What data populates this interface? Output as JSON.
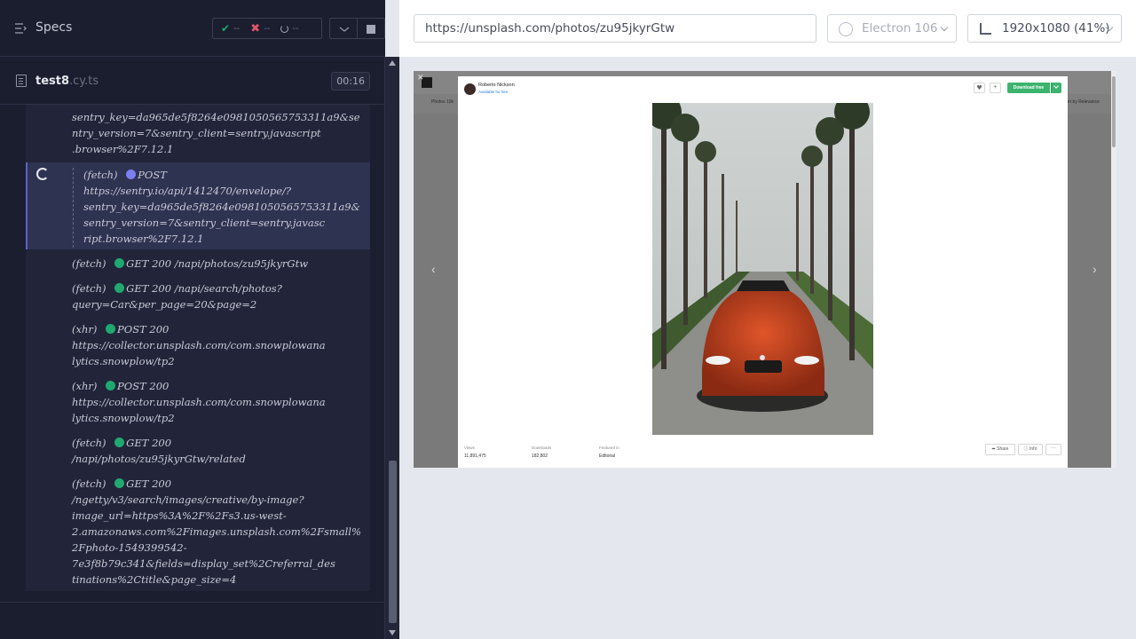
{
  "sidebar": {
    "specs_label": "Specs",
    "stats": {
      "passed": "--",
      "failed": "--",
      "pending": "--"
    },
    "file": {
      "name": "test8",
      "ext": ".cy.ts",
      "timer": "00:16"
    }
  },
  "command_log": [
    {
      "lines": [
        "sentry_key=da965de5f8264e0981050565753311a9&se",
        "ntry_version=7&sentry_client=sentry.javascript",
        ".browser%2F7.12.1"
      ]
    },
    {
      "type": "(fetch)",
      "method": "POST",
      "status": "",
      "dot": "blue",
      "active": true,
      "lines": [
        "https://sentry.io/api/1412470/envelope/?",
        "sentry_key=da965de5f8264e0981050565753311a9&",
        "sentry_version=7&sentry_client=sentry.javasc",
        "ript.browser%2F7.12.1"
      ]
    },
    {
      "type": "(fetch)",
      "method": "GET",
      "status": "200",
      "dot": "green",
      "inline": "/napi/photos/zu95jkyrGtw"
    },
    {
      "type": "(fetch)",
      "method": "GET",
      "status": "200",
      "dot": "green",
      "inline": "/napi/search/photos?",
      "lines": [
        "query=Car&per_page=20&page=2"
      ]
    },
    {
      "type": "(xhr)",
      "method": "POST",
      "status": "200",
      "dot": "green",
      "lines": [
        "https://collector.unsplash.com/com.snowplowana",
        "lytics.snowplow/tp2"
      ]
    },
    {
      "type": "(xhr)",
      "method": "POST",
      "status": "200",
      "dot": "green",
      "lines": [
        "https://collector.unsplash.com/com.snowplowana",
        "lytics.snowplow/tp2"
      ]
    },
    {
      "type": "(fetch)",
      "method": "GET",
      "status": "200",
      "dot": "green",
      "lines": [
        "/napi/photos/zu95jkyrGtw/related"
      ]
    },
    {
      "type": "(fetch)",
      "method": "GET",
      "status": "200",
      "dot": "green",
      "lines": [
        "/ngetty/v3/search/images/creative/by-image?",
        "image_url=https%3A%2F%2Fs3.us-west-",
        "2.amazonaws.com%2Fimages.unsplash.com%2Fsmall%",
        "2Fphoto-1549399542-",
        "7e3f8b79c341&fields=display_set%2Creferral_des",
        "tinations%2Ctitle&page_size=4"
      ]
    }
  ],
  "topbar": {
    "url": "https://unsplash.com/photos/zu95jkyrGtw",
    "browser": "Electron 106",
    "viewport": "1920x1080  (41%)"
  },
  "aut": {
    "bg_tab": "Photos 10k",
    "bg_right": "Sort by Relevance",
    "author": "Roberto Nickson",
    "hire": "Available for hire",
    "download": "Download free",
    "stats": [
      {
        "label": "Views",
        "value": "11,891,475"
      },
      {
        "label": "Downloads",
        "value": "182,802"
      },
      {
        "label": "Featured in",
        "value": "Editorial"
      }
    ],
    "share": "Share",
    "info": "Info",
    "more": "···"
  },
  "colors": {
    "sidebar_bg": "#1b1e2e",
    "log_bg": "#22253a",
    "green_dot": "#1fa971",
    "blue_dot": "#7c7ff0",
    "download_green": "#3cb46e"
  }
}
